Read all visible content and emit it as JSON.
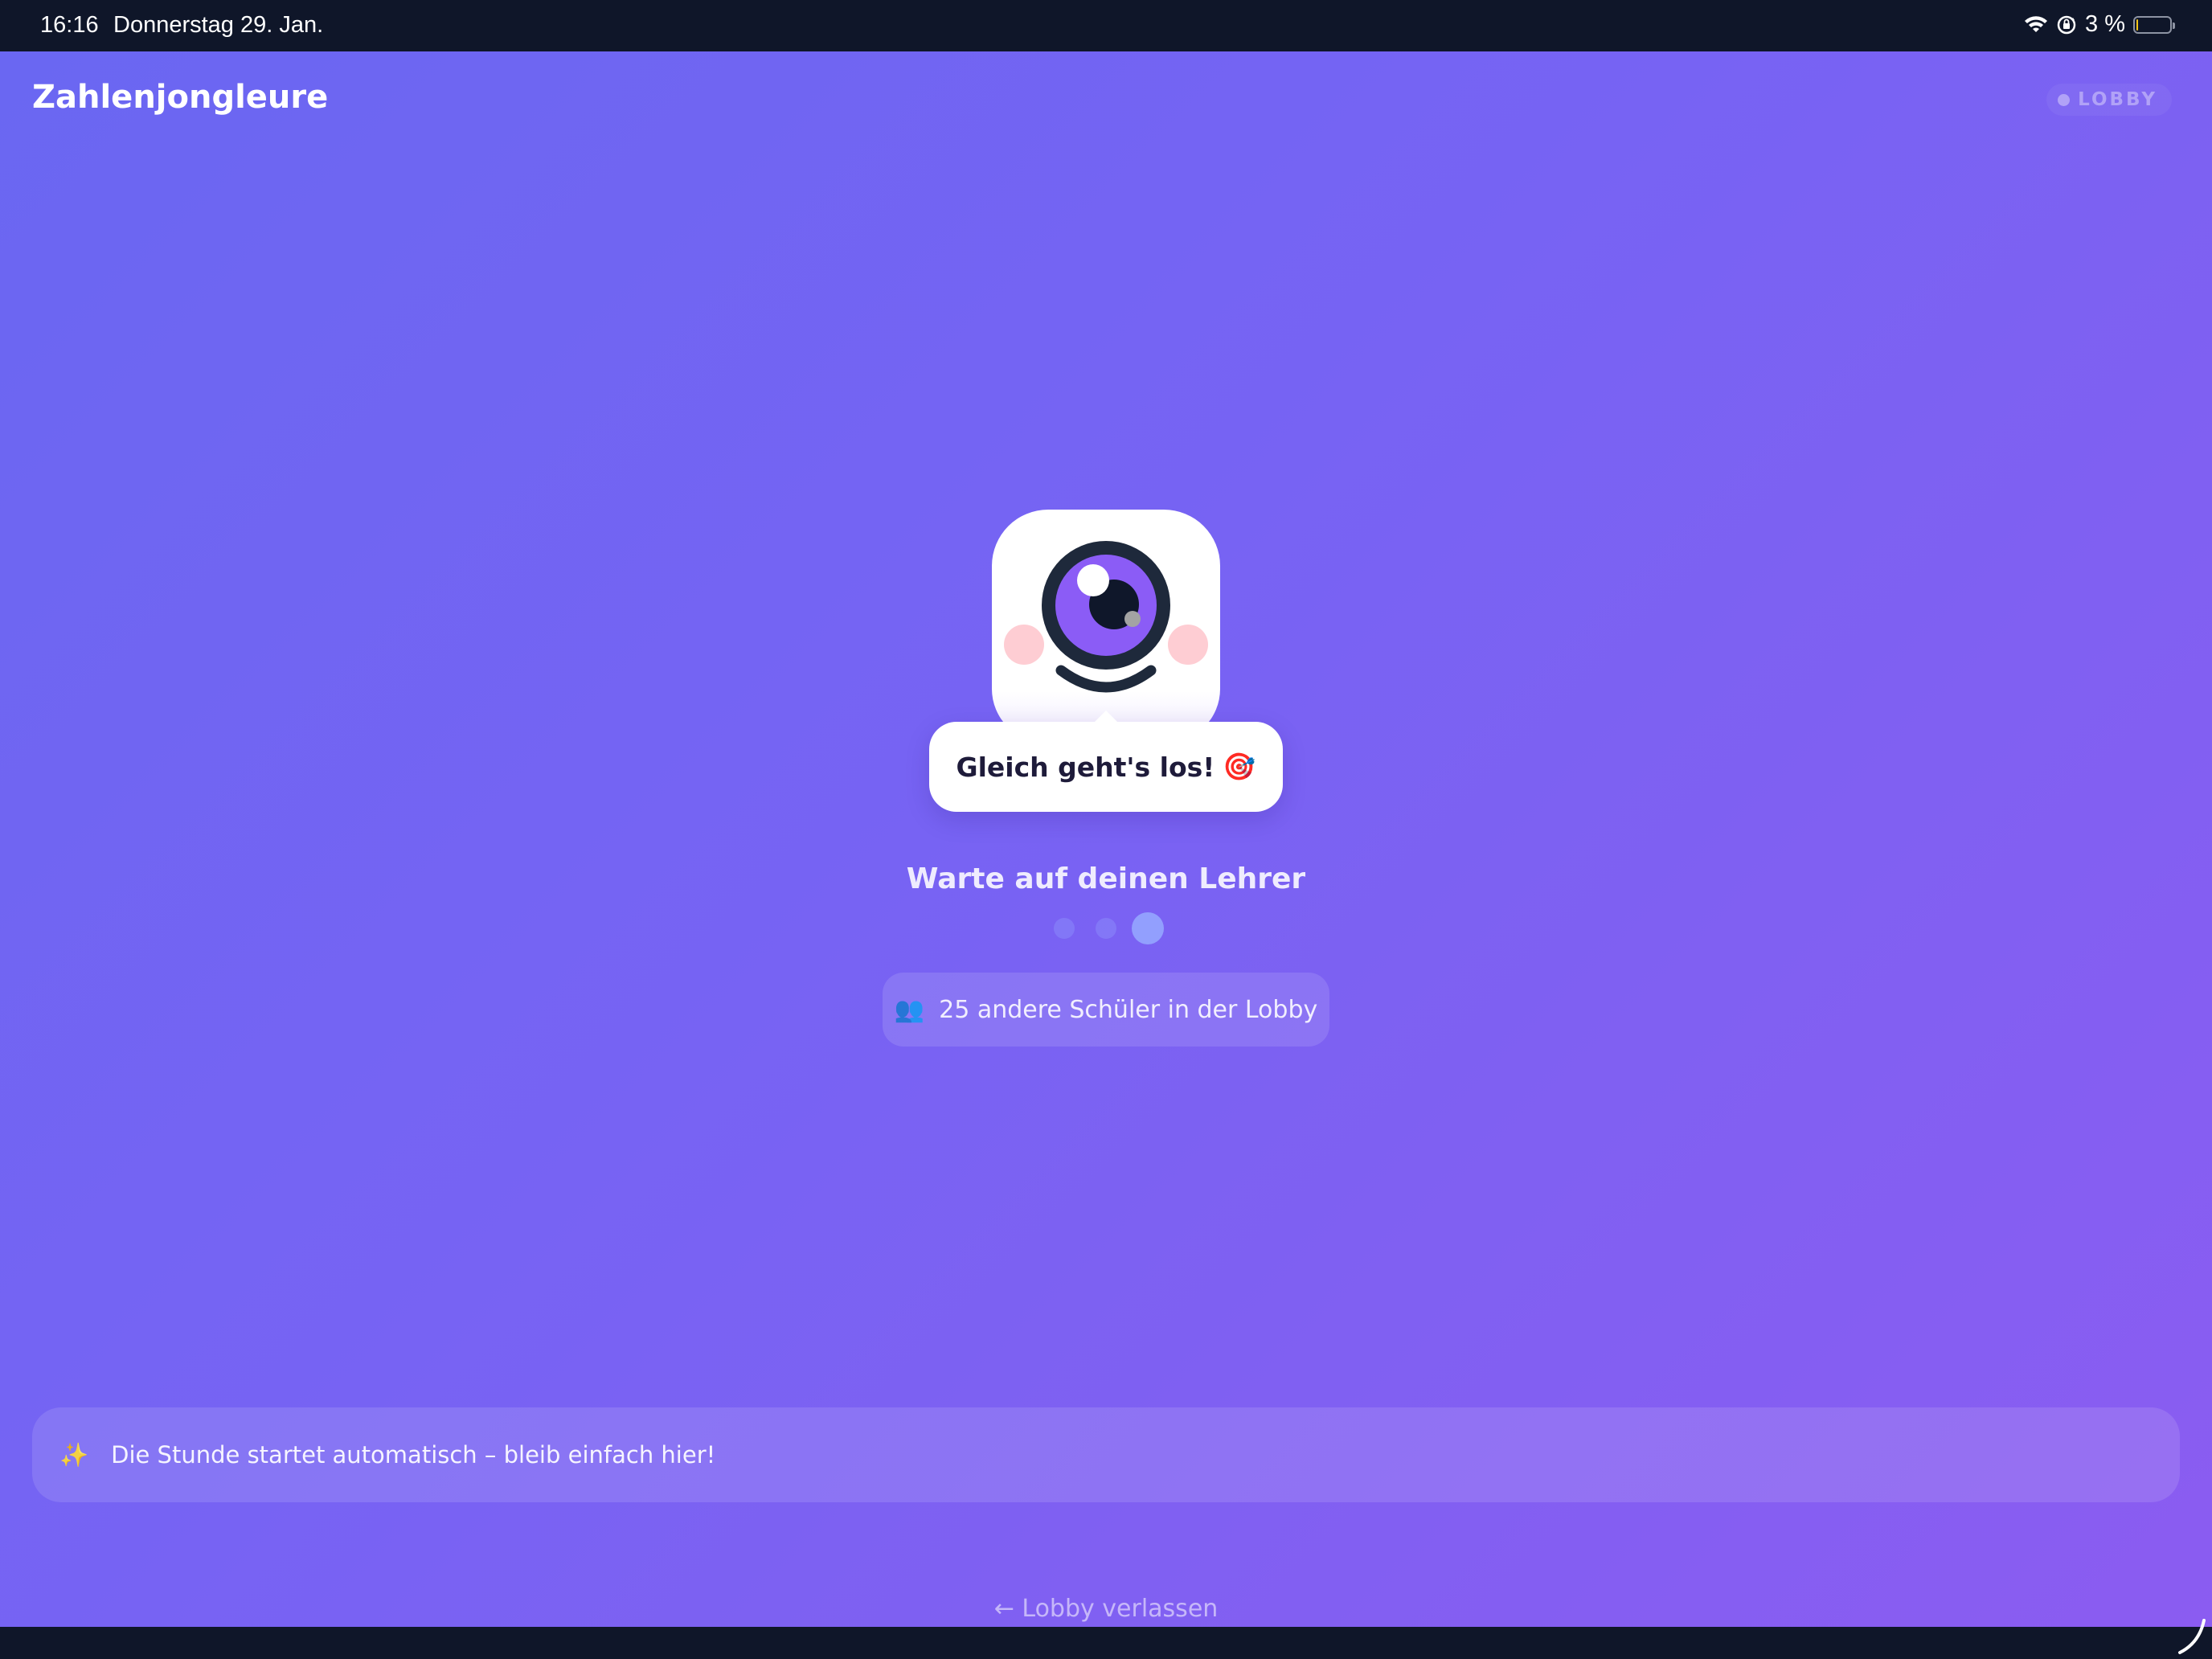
{
  "status_bar": {
    "time": "16:16",
    "date": "Donnerstag 29. Jan.",
    "battery_text": "3 %",
    "battery_level": 0.03,
    "icons": [
      "wifi-icon",
      "orientation-lock-icon",
      "battery-icon"
    ]
  },
  "header": {
    "title": "Zahlenjongleure",
    "badge": "LOBBY"
  },
  "mascot": {
    "icon": "eye-mascot-icon"
  },
  "bubble": {
    "text": "Gleich geht's los!",
    "emoji": "🎯"
  },
  "waiting": {
    "text": "Warte auf deinen Lehrer",
    "dots_total": 3,
    "dots_active": 3
  },
  "lobby_count": {
    "emoji": "👥",
    "text": "25 andere Schüler in der Lobby"
  },
  "hint": {
    "emoji": "✨",
    "text": "Die Stunde startet automatisch – bleib einfach hier!"
  },
  "leave": {
    "label": "← Lobby verlassen"
  },
  "colors": {
    "gradient_start": "#6a67f2",
    "gradient_end": "#8b5cf1",
    "status_bar_bg": "#0f1629",
    "bubble_text": "#1e1b3a",
    "eye_iris": "#8b5cf6",
    "eye_ring": "#1e293b",
    "cheek": "#fecdd3"
  }
}
